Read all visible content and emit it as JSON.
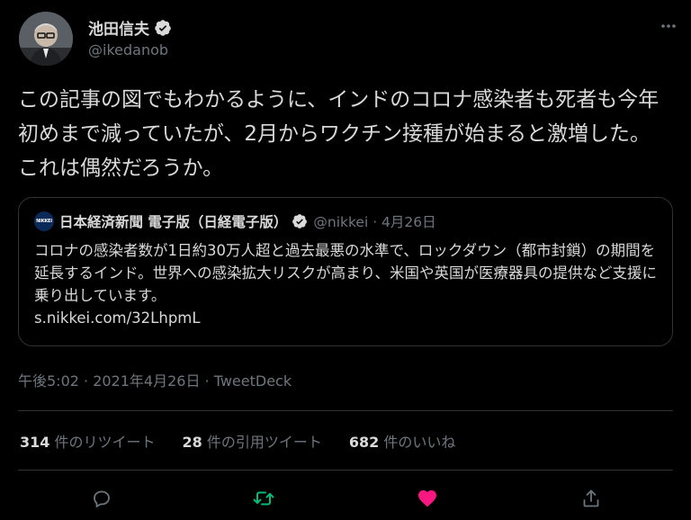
{
  "author": {
    "display_name": "池田信夫",
    "handle": "@ikedanob"
  },
  "tweet": {
    "text": "この記事の図でもわかるように、インドのコロナ感染者も死者も今年初めまで減っていたが、2月からワクチン接種が始まると激増した。これは偶然だろうか。",
    "timestamp": "午後5:02 · 2021年4月26日 · TweetDeck"
  },
  "quoted": {
    "logo_text": "NIKKEI",
    "name": "日本経済新聞 電子版（日経電子版）",
    "meta": "@nikkei · 4月26日",
    "text": "コロナの感染者数が1日約30万人超と過去最悪の水準で、ロックダウン（都市封鎖）の期間を延長するインド。世界への感染拡大リスクが高まり、米国や英国が医療器具の提供など支援に乗り出しています。",
    "link": "s.nikkei.com/32LhpmL"
  },
  "stats": {
    "retweets_count": "314",
    "retweets_label": " 件のリツイート",
    "quotes_count": "28",
    "quotes_label": " 件の引用ツイート",
    "likes_count": "682",
    "likes_label": " 件のいいね"
  },
  "colors": {
    "background": "#000000",
    "text": "#d9d9d9",
    "secondary": "#6e767d",
    "verified": "#1d9bf0",
    "retweet": "#00ba7c",
    "like": "#f91880",
    "border": "#2f3336"
  },
  "icons": [
    "verified-icon",
    "more-icon",
    "reply-icon",
    "retweet-icon",
    "like-icon",
    "share-icon"
  ]
}
